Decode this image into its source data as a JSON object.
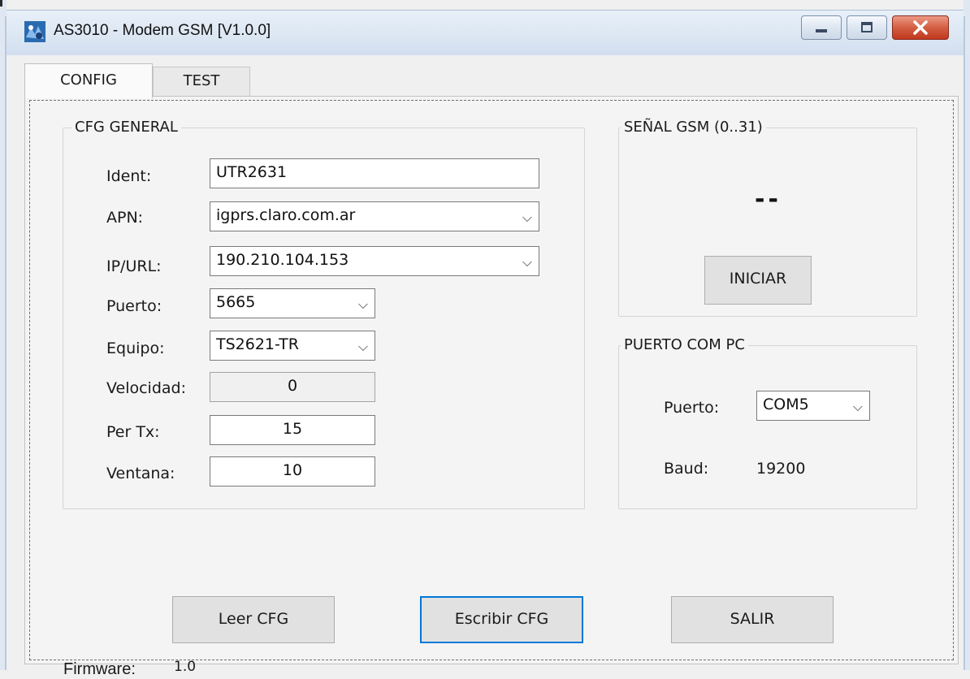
{
  "window": {
    "title": "AS3010 - Modem GSM [V1.0.0]",
    "icon": "app-icon"
  },
  "tabs": [
    {
      "label": "CONFIG",
      "active": true
    },
    {
      "label": "TEST",
      "active": false
    }
  ],
  "cfg_general": {
    "title": "CFG GENERAL",
    "ident": {
      "label": "Ident:",
      "value": "UTR2631"
    },
    "apn": {
      "label": "APN:",
      "value": "igprs.claro.com.ar"
    },
    "ip_url": {
      "label": "IP/URL:",
      "value": "190.210.104.153"
    },
    "puerto": {
      "label": "Puerto:",
      "value": "5665"
    },
    "equipo": {
      "label": "Equipo:",
      "value": "TS2621-TR"
    },
    "velocidad": {
      "label": "Velocidad:",
      "value": "0"
    },
    "per_tx": {
      "label": "Per Tx:",
      "value": "15"
    },
    "ventana": {
      "label": "Ventana:",
      "value": "10"
    }
  },
  "signal": {
    "title": "SEÑAL GSM (0..31)",
    "value": "--",
    "start_button": "INICIAR"
  },
  "com_port": {
    "title": "PUERTO COM PC",
    "port_label": "Puerto:",
    "port_value": "COM5",
    "baud_label": "Baud:",
    "baud_value": "19200"
  },
  "actions": {
    "read": "Leer CFG",
    "write": "Escribir CFG",
    "exit": "SALIR"
  },
  "firmware": {
    "label": "Firmware:",
    "value": "1.0"
  },
  "colors": {
    "focus_accent": "#0078d7",
    "close_button": "#c7452a"
  }
}
